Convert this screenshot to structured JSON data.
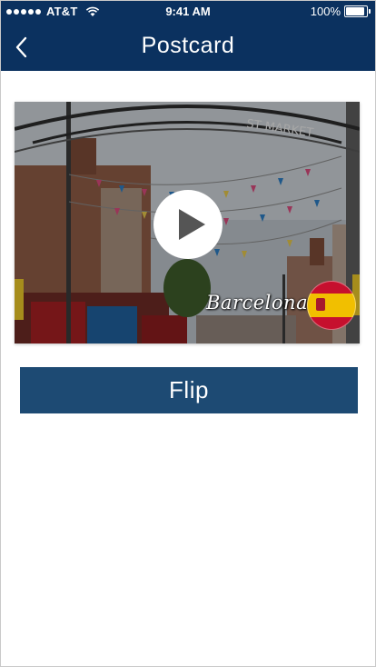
{
  "status_bar": {
    "carrier": "AT&T",
    "time": "9:41 AM",
    "battery": "100%"
  },
  "nav": {
    "title": "Postcard"
  },
  "postcard": {
    "caption": "Barcelona",
    "arch_sign": "ST MARKET",
    "flag_icon": "spain-flag-icon"
  },
  "actions": {
    "flip_label": "Flip"
  },
  "colors": {
    "header": "#0b315f",
    "button": "#1d4a73"
  }
}
